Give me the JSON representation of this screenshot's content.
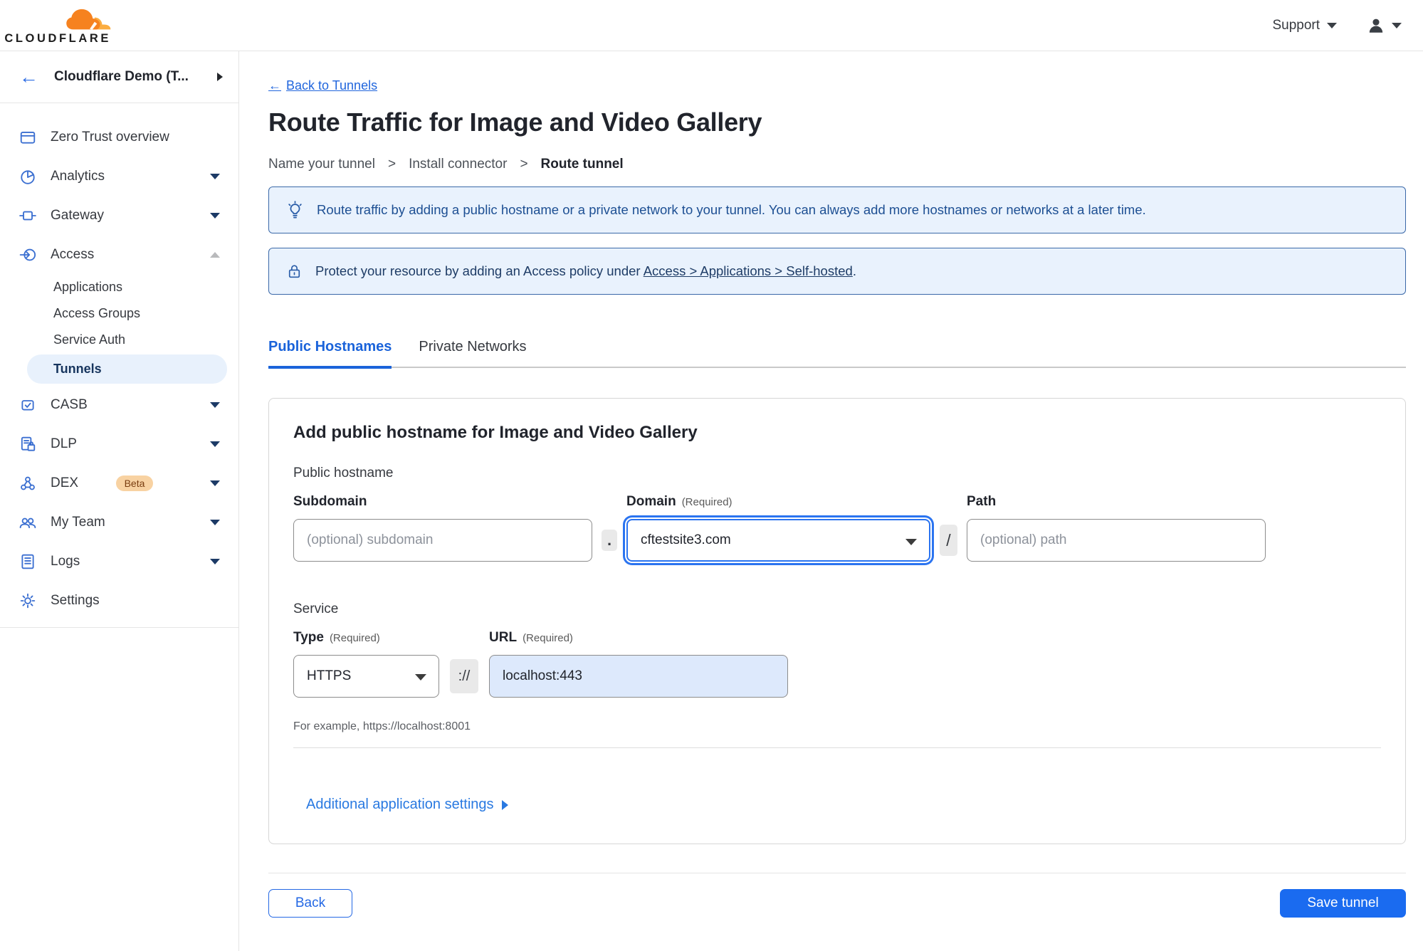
{
  "topbar": {
    "brand": "CLOUDFLARE",
    "support_label": "Support"
  },
  "sidebar": {
    "account": "Cloudflare Demo (T...",
    "back_arrow": "←",
    "items": [
      {
        "label": "Zero Trust overview"
      },
      {
        "label": "Analytics"
      },
      {
        "label": "Gateway"
      },
      {
        "label": "Access"
      },
      {
        "label": "Applications"
      },
      {
        "label": "Access Groups"
      },
      {
        "label": "Service Auth"
      },
      {
        "label": "Tunnels"
      },
      {
        "label": "CASB"
      },
      {
        "label": "DLP"
      },
      {
        "label": "DEX",
        "badge": "Beta"
      },
      {
        "label": "My Team"
      },
      {
        "label": "Logs"
      },
      {
        "label": "Settings"
      }
    ]
  },
  "main": {
    "back_arrow": "←",
    "back_link": "Back to Tunnels",
    "title": "Route Traffic for Image and Video Gallery",
    "steps": {
      "s1": "Name your tunnel",
      "s2": "Install connector",
      "s3": "Route tunnel",
      "separator": ">"
    },
    "banners": {
      "tip": "Route traffic by adding a public hostname or a private network to your tunnel. You can always add more hostnames or networks at a later time.",
      "access_prefix": "Protect your resource by adding an Access policy under ",
      "access_link": "Access > Applications > Self-hosted",
      "access_suffix": "."
    },
    "tabs": {
      "public": "Public Hostnames",
      "private": "Private Networks"
    },
    "form": {
      "heading": "Add public hostname for Image and Video Gallery",
      "section_hostname": "Public hostname",
      "subdomain_label": "Subdomain",
      "subdomain_placeholder": "(optional) subdomain",
      "dot": ".",
      "domain_label": "Domain",
      "required": "(Required)",
      "domain_value": "cftestsite3.com",
      "slash": "/",
      "path_label": "Path",
      "path_placeholder": "(optional) path",
      "section_service": "Service",
      "type_label": "Type",
      "type_value": "HTTPS",
      "scheme_sep": "://",
      "url_label": "URL",
      "url_value": "localhost:443",
      "url_hint": "For example, https://localhost:8001",
      "additional_settings": "Additional application settings"
    },
    "footer": {
      "back": "Back",
      "save": "Save tunnel"
    }
  },
  "colors": {
    "accent_blue": "#1a6bf0",
    "link_blue": "#2166dd",
    "tab_blue": "#1a63da",
    "banner_bg": "#e9f2fd",
    "banner_border": "#3a68a8",
    "selected_item_bg": "#e8f1fc",
    "logo_orange": "#f6821f",
    "logo_orange_light": "#fbad41",
    "url_input_bg": "#dde9fc"
  }
}
